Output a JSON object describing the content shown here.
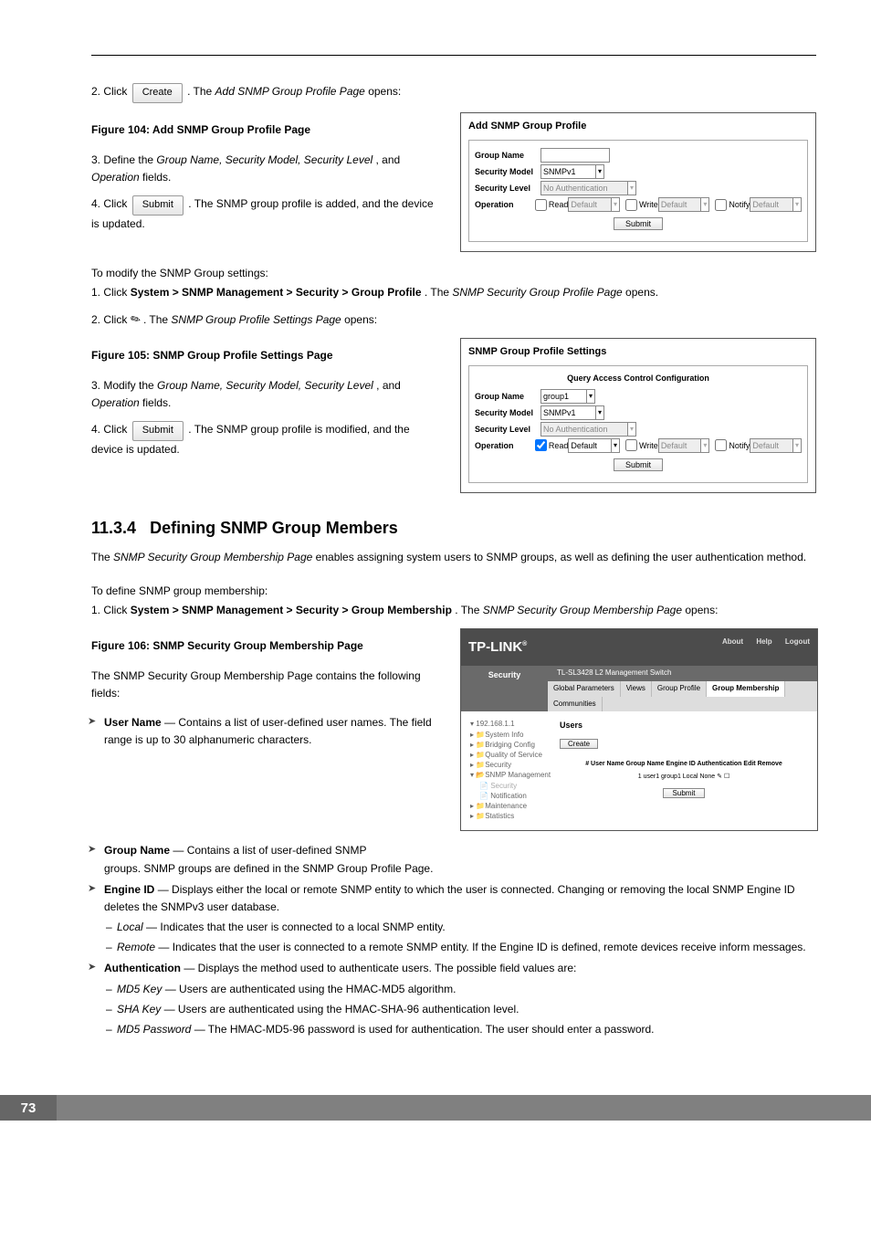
{
  "top": {
    "step2_a": "2.  Click ",
    "step2_btn": "Create",
    "step2_b": ". The ",
    "step2_ital": "Add SNMP Group Profile Page",
    "step2_c": " opens:"
  },
  "fig104": {
    "caption": "Figure 104: Add SNMP Group Profile Page",
    "panel_title": "Add SNMP Group Profile",
    "labels": {
      "gn": "Group Name",
      "sm": "Security Model",
      "sl": "Security Level",
      "op": "Operation"
    },
    "sm_val": "SNMPv1",
    "sl_val": "No Authentication",
    "op": {
      "read_chk": "Read",
      "write_chk": "Write",
      "notify_chk": "Notify",
      "default": "Default"
    },
    "submit": "Submit"
  },
  "sec_a": {
    "step3_a": "3.  Define the ",
    "step3_ital": "Group Name, Security Model, Security Level",
    "step3_b": ", and ",
    "step3_ital2": "Operation",
    "step3_c": " fields.",
    "step4_a": "4.  Click ",
    "step4_btn": "Submit",
    "step4_b": ". The SNMP group profile is added, and the device is updated."
  },
  "modify": {
    "intro": "To modify the SNMP Group settings:",
    "step1_a": "1.  Click ",
    "step1_bold": "System > SNMP Management > Security > Group Profile",
    "step1_b": ". The ",
    "step1_ital": "SNMP Security Group Profile Page",
    "step1_c": " opens.",
    "step2_a": "2.  Click ",
    "step2_b": " . The ",
    "step2_ital": "SNMP Group Profile Settings Page",
    "step2_c": " opens:"
  },
  "fig105": {
    "caption": "Figure 105: SNMP Group Profile Settings Page",
    "panel_title": "SNMP Group Profile Settings",
    "hdr": "Query Access Control Configuration",
    "labels": {
      "gn": "Group Name",
      "sm": "Security Model",
      "sl": "Security Level",
      "op": "Operation"
    },
    "gn_val": "group1",
    "sm_val": "SNMPv1",
    "sl_val": "No Authentication",
    "op": {
      "read_chk": "Read",
      "write_chk": "Write",
      "notify_chk": "Notify",
      "default": "Default"
    },
    "submit": "Submit"
  },
  "sec_b": {
    "step3_a": "3.   Modify the ",
    "step3_ital": "Group Name, Security Model, Security Level",
    "step3_b": ", and ",
    "step3_ital2": "Operation",
    "step3_c": " fields.",
    "step4_a": "4.  Click ",
    "step4_btn": "Submit",
    "step4_b": ". The SNMP group profile is modified, and the device is updated."
  },
  "section": {
    "num": "11.3.4",
    "title": "Defining SNMP Group Members",
    "intro_a": "The ",
    "intro_ital": "SNMP Security Group Membership Page",
    "intro_b": " enables assigning system users to SNMP groups, as well as defining the user authentication method.",
    "todef": "To define SNMP group membership:",
    "step1_a": "1.  Click ",
    "step1_bold": "System > SNMP Management > Security > Group Membership",
    "step1_b": ". The ",
    "step1_ital": "SNMP Security Group Membership Page",
    "step1_c": " opens:"
  },
  "fig106": {
    "caption": "Figure 106: SNMP Security Group Membership Page",
    "brand": "TP-LINK",
    "device": "TL-SL3428 L2 Management Switch",
    "about": "About",
    "help": "Help",
    "logout": "Logout",
    "side_hdr": "Security",
    "tabs": [
      "Global Parameters",
      "Views",
      "Group Profile",
      "Group Membership",
      "Communities"
    ],
    "active_tab": 3,
    "nav": [
      "192.168.1.1",
      "System Info",
      "Bridging Config",
      "Quality of Service",
      "Security",
      "SNMP Management",
      "  Security",
      "  Notification",
      "Maintenance",
      "Statistics"
    ],
    "main_hd": "Users",
    "create": "Create",
    "theaders": "# User Name Group Name Engine ID Authentication Edit Remove",
    "trow": "1   user1     group1     Local    None      ✎    ☐",
    "submit": "Submit"
  },
  "fields_intro": "The SNMP Security Group Membership Page contains the following fields:",
  "fields": {
    "user_name_label": "User Name",
    "user_name_desc": " — Contains a list of user-defined user names. The field range is up to 30 alphanumeric characters.",
    "group_name_label": "Group Name",
    "group_name_desc_a": " — Contains a list of user-defined SNMP",
    "group_name_desc_b": "groups. SNMP groups are defined in the SNMP Group Profile Page.",
    "engine_id_label": "Engine ID",
    "engine_id_desc": " — Displays either the local or remote SNMP entity to which the user is connected. Changing or removing the local SNMP Engine ID deletes the SNMPv3 user database.",
    "local_label": "Local",
    "local_desc": " — Indicates that the user is connected to a local SNMP entity.",
    "remote_label": "Remote",
    "remote_desc": " — Indicates that the user is connected to a remote SNMP entity. If the Engine ID is defined, remote devices receive inform messages.",
    "auth_label": "Authentication",
    "auth_desc": " — Displays the method used to authenticate users. The possible field values are:",
    "md5_label": "MD5 Key",
    "md5_desc": " — Users are authenticated using the HMAC-MD5 algorithm.",
    "sha_label": "SHA Key",
    "sha_desc": " — Users are authenticated using the HMAC-SHA-96 authentication level.",
    "md5pw_label": "MD5 Password",
    "md5pw_desc": " — The HMAC-MD5-96 password is used for authentication. The user should enter a password."
  },
  "page_number": "73"
}
